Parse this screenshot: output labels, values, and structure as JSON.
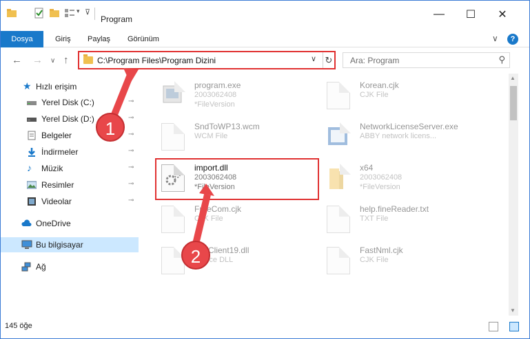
{
  "window": {
    "title": "Program",
    "minimize": "—",
    "maximize": "☐",
    "close": "✕"
  },
  "ribbon": {
    "tabs": [
      "Dosya",
      "Giriş",
      "Paylaş",
      "Görünüm"
    ],
    "expand": "∨",
    "help": "?"
  },
  "nav": {
    "back": "←",
    "forward": "→",
    "recent": "∨",
    "up": "↑",
    "address": "C:\\Program Files\\Program Dizini",
    "address_dropdown": "∨",
    "refresh": "↻",
    "search_placeholder": "Ara: Program",
    "search_icon": "⚲"
  },
  "sidebar": {
    "items": [
      {
        "label": "Hızlı erişim",
        "icon": "star-icon"
      },
      {
        "label": "Yerel Disk (C:)",
        "icon": "drive-icon"
      },
      {
        "label": "Yerel Disk (D:)",
        "icon": "drive-icon"
      },
      {
        "label": "Belgeler",
        "icon": "documents-icon"
      },
      {
        "label": "İndirmeler",
        "icon": "download-icon"
      },
      {
        "label": "Müzik",
        "icon": "music-icon"
      },
      {
        "label": "Resimler",
        "icon": "pictures-icon"
      },
      {
        "label": "Videolar",
        "icon": "videos-icon"
      },
      {
        "label": "OneDrive",
        "icon": "cloud-icon"
      },
      {
        "label": "Bu bilgisayar",
        "icon": "computer-icon"
      },
      {
        "label": "Ağ",
        "icon": "network-icon"
      }
    ],
    "pin": "⊸"
  },
  "files": {
    "program_exe": {
      "name": "program.exe",
      "line2": "2003062408",
      "line3": "*FileVersion"
    },
    "korean": {
      "name": "Korean.cjk",
      "line2": "CJK File"
    },
    "sndto": {
      "name": "SndToWP13.wcm",
      "line2": "WCM File"
    },
    "network": {
      "name": "NetworkLicenseServer.exe",
      "line2": "ABBY network licens..."
    },
    "import_dll": {
      "name": "import.dll",
      "line2": "2003062408",
      "line3": "*FileVersion"
    },
    "x64": {
      "name": "x64",
      "line2": "2003062408",
      "line3": "*FileVersion"
    },
    "freecom": {
      "name": "FreeCom.cjk",
      "line2": "CJK File"
    },
    "help_txt": {
      "name": "help.fineReader.txt",
      "line2": "TXT File"
    },
    "dll2": {
      "name": "...teClient19.dll",
      "line2": "...ance DLL"
    },
    "fastnml": {
      "name": "FastNml.cjk",
      "line2": "CJK File"
    }
  },
  "callouts": {
    "one": "1",
    "two": "2"
  },
  "status": {
    "count": "145 öğe"
  },
  "colors": {
    "accent": "#1979ca",
    "highlight": "#e03030",
    "callout": "#e8474a"
  }
}
